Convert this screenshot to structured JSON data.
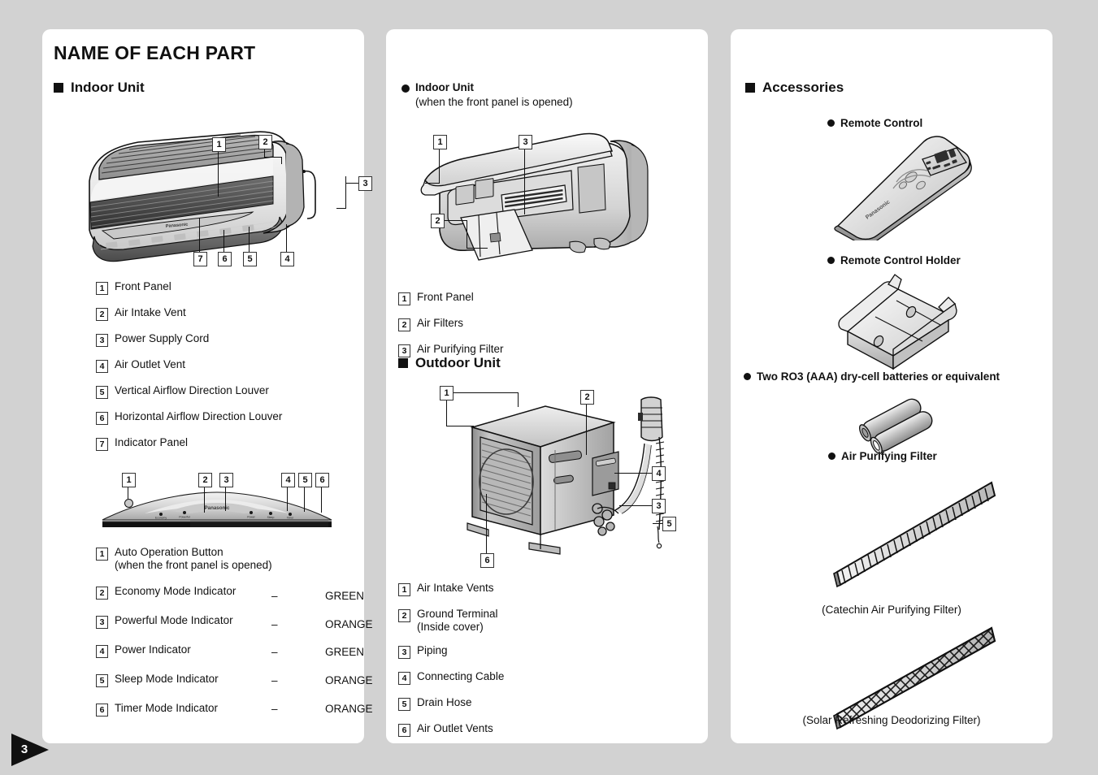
{
  "page": {
    "number": "3"
  },
  "column1": {
    "title": "NAME OF EACH PART",
    "section_heading": "Indoor Unit",
    "figure_callouts": [
      "1",
      "2",
      "3",
      "4",
      "5",
      "6",
      "7"
    ],
    "parts": [
      {
        "num": "1",
        "label": "Front Panel"
      },
      {
        "num": "2",
        "label": "Air Intake Vent"
      },
      {
        "num": "3",
        "label": "Power Supply Cord"
      },
      {
        "num": "4",
        "label": "Air Outlet Vent"
      },
      {
        "num": "5",
        "label": "Vertical Airflow Direction Louver"
      },
      {
        "num": "6",
        "label": "Horizontal Airflow Direction Louver"
      },
      {
        "num": "7",
        "label": "Indicator Panel"
      }
    ],
    "indicator_panel": {
      "brand": "Panasonic",
      "led_labels": [
        "Economy",
        "Powerful",
        "Power",
        "Sleep",
        "Timer"
      ],
      "callouts": [
        "1",
        "2",
        "3",
        "4",
        "5",
        "6"
      ],
      "items": [
        {
          "num": "1",
          "label": "Auto Operation Button",
          "note": "(when the front panel is opened)",
          "dash": "",
          "color": ""
        },
        {
          "num": "2",
          "label": "Economy Mode Indicator",
          "note": "",
          "dash": "–",
          "color": "GREEN"
        },
        {
          "num": "3",
          "label": "Powerful Mode Indicator",
          "note": "",
          "dash": "–",
          "color": "ORANGE"
        },
        {
          "num": "4",
          "label": "Power Indicator",
          "note": "",
          "dash": "–",
          "color": "GREEN"
        },
        {
          "num": "5",
          "label": "Sleep Mode Indicator",
          "note": "",
          "dash": "–",
          "color": "ORANGE"
        },
        {
          "num": "6",
          "label": "Timer Mode Indicator",
          "note": "",
          "dash": "–",
          "color": "ORANGE"
        }
      ]
    }
  },
  "column2": {
    "indoor_open": {
      "heading": "Indoor Unit",
      "subheading": "(when the front panel is opened)",
      "callouts": [
        "1",
        "2",
        "3"
      ],
      "parts": [
        {
          "num": "1",
          "label": "Front Panel"
        },
        {
          "num": "2",
          "label": "Air Filters"
        },
        {
          "num": "3",
          "label": "Air Purifying Filter"
        }
      ]
    },
    "outdoor": {
      "heading": "Outdoor Unit",
      "callouts": [
        "1",
        "2",
        "3",
        "4",
        "5",
        "6"
      ],
      "parts": [
        {
          "num": "1",
          "label": "Air Intake Vents",
          "note": ""
        },
        {
          "num": "2",
          "label": "Ground Terminal",
          "note": "(Inside cover)"
        },
        {
          "num": "3",
          "label": "Piping",
          "note": ""
        },
        {
          "num": "4",
          "label": "Connecting Cable",
          "note": ""
        },
        {
          "num": "5",
          "label": "Drain Hose",
          "note": ""
        },
        {
          "num": "6",
          "label": "Air Outlet Vents",
          "note": ""
        }
      ]
    }
  },
  "column3": {
    "heading": "Accessories",
    "items": [
      {
        "label": "Remote Control",
        "caption": "",
        "brand": "Panasonic"
      },
      {
        "label": "Remote Control Holder",
        "caption": ""
      },
      {
        "label": "Two RO3 (AAA) dry-cell batteries or equivalent",
        "caption": ""
      },
      {
        "label": "Air Purifying Filter",
        "caption": "(Catechin Air Purifying Filter)"
      },
      {
        "label": "",
        "caption": "(Solar Refreshing Deodorizing Filter)"
      }
    ]
  },
  "colors": {
    "page_background": "#d2d2d2",
    "card_background": "#ffffff",
    "ink": "#111111",
    "green_text": "GREEN",
    "orange_text": "ORANGE"
  }
}
